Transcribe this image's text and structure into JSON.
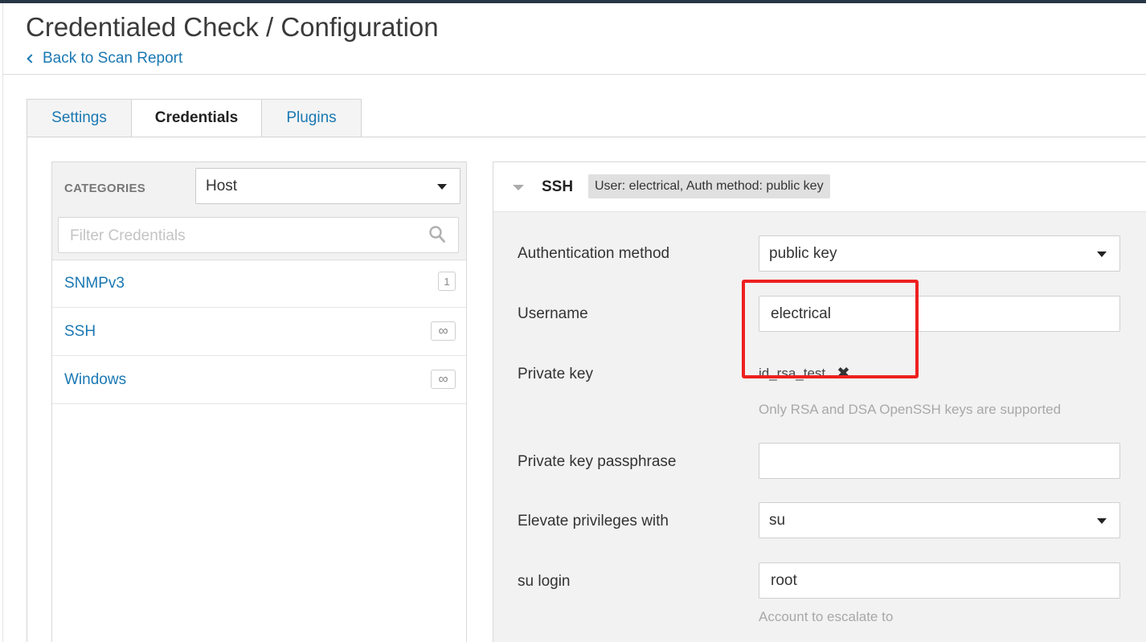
{
  "page": {
    "title": "Credentialed Check / Configuration",
    "back_link": "Back to Scan Report"
  },
  "tabs": [
    {
      "label": "Settings",
      "active": false
    },
    {
      "label": "Credentials",
      "active": true
    },
    {
      "label": "Plugins",
      "active": false
    }
  ],
  "categories": {
    "header_label": "CATEGORIES",
    "selected": "Host",
    "filter_placeholder": "Filter Credentials",
    "items": [
      {
        "label": "SNMPv3",
        "badge": "1"
      },
      {
        "label": "SSH",
        "badge": "∞"
      },
      {
        "label": "Windows",
        "badge": "∞"
      }
    ]
  },
  "ssh": {
    "title": "SSH",
    "summary": "User: electrical, Auth method: public key",
    "fields": {
      "auth_method": {
        "label": "Authentication method",
        "value": "public key"
      },
      "username": {
        "label": "Username",
        "value": "electrical"
      },
      "private_key": {
        "label": "Private key",
        "filename": "id_rsa_test",
        "remove_symbol": "✖",
        "help": "Only RSA and DSA OpenSSH keys are supported"
      },
      "passphrase": {
        "label": "Private key passphrase",
        "value": ""
      },
      "elevate": {
        "label": "Elevate privileges with",
        "value": "su"
      },
      "su_login": {
        "label": "su login",
        "value": "root",
        "help": "Account to escalate to"
      }
    }
  },
  "colors": {
    "link": "#1a78b3",
    "annotation_red": "#ee2020",
    "topbar": "#263645"
  },
  "icons": {
    "back": "chevron-left-icon",
    "search": "search-icon",
    "dropdown": "caret-down-icon",
    "collapse": "caret-down-icon",
    "remove": "close-icon"
  }
}
